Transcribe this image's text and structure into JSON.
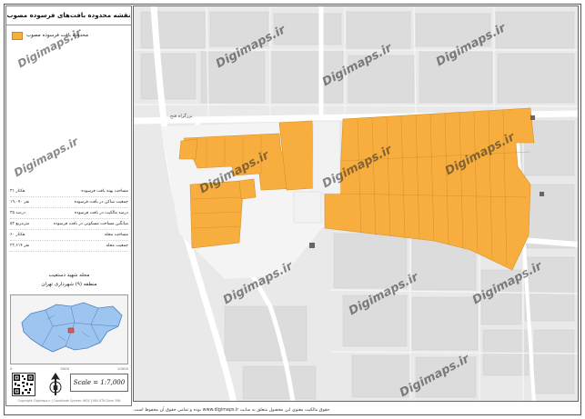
{
  "map_title": "نقشه محدوده بافت‌های فرسوده مصوب",
  "legend": {
    "label": "محدوده بافت فرسوده مصوب",
    "color": "#F7AE3E"
  },
  "stats": [
    {
      "label": "مساحت پهنه بافت فرسوده",
      "value": "۳۱ هکتار"
    },
    {
      "label": "جمعیت ساکن در بافت فرسوده",
      "value": "۱۹,۰۷۰ نفر"
    },
    {
      "label": "درصد مالکیت در بافت فرسوده",
      "value": "۳۵ درصد"
    },
    {
      "label": "میانگین مساحت مسکونی در بافت فرسوده",
      "value": "۵۲ مترمربع"
    },
    {
      "label": "مساحت محله",
      "value": "۶۰ هکتار"
    },
    {
      "label": "جمعیت محله",
      "value": "۲۲,۶۱۴ نفر"
    }
  ],
  "location": {
    "neighborhood": "محله شهید دستغیب",
    "district": "منطقه (۹) شهرداری تهران"
  },
  "inset_caption": {
    "left": "0",
    "mid": "5000",
    "right": "10000"
  },
  "scale": "Scale = 1:7,000",
  "north_label": "N",
  "side_footer": "Copyright: Digimaps.ir  |  Coordinate System: WGS 1984 UTM Zone 39N",
  "map_labels": {
    "label_1": "بزرگراه فتح"
  },
  "watermark": "Digimaps.ir",
  "footer": "حقوق مالکیت معنوی این محصول متعلق به سایت www.digimaps.ir بوده و تمامی حقوق آن محفوظ است.",
  "colors": {
    "worn_texture": "#F7AE3E",
    "road_major": "#ffffff",
    "background": "#e9e9e9",
    "inset_district": "#9ec5f0"
  }
}
